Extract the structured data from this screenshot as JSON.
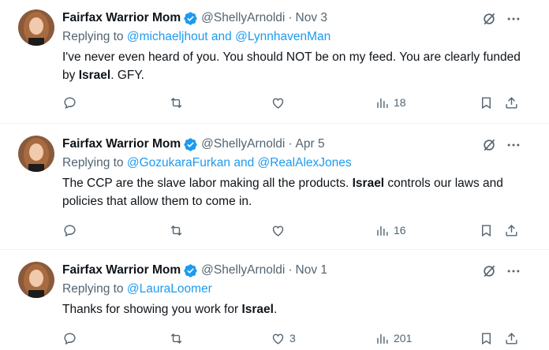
{
  "tweets": [
    {
      "author": "Fairfax Warrior Mom",
      "handle": "@ShellyArnoldi",
      "separator": "·",
      "date": "Nov 3",
      "replying_prefix": "Replying to ",
      "mentions": "@michaeljhout and @LynnhavenMan",
      "text_parts": [
        "I've never even heard of you. You should NOT be on my feed. You are clearly funded by ",
        "Israel",
        ". GFY."
      ],
      "likes": "",
      "views": "18"
    },
    {
      "author": "Fairfax Warrior Mom",
      "handle": "@ShellyArnoldi",
      "separator": "·",
      "date": "Apr 5",
      "replying_prefix": "Replying to ",
      "mentions": "@GozukaraFurkan and @RealAlexJones",
      "text_parts": [
        "The CCP are the slave labor making all the products. ",
        "Israel",
        " controls our laws and policies that allow them to come in."
      ],
      "likes": "",
      "views": "16"
    },
    {
      "author": "Fairfax Warrior Mom",
      "handle": "@ShellyArnoldi",
      "separator": "·",
      "date": "Nov 1",
      "replying_prefix": "Replying to ",
      "mentions": "@LauraLoomer",
      "text_parts": [
        "Thanks for showing you work for ",
        "Israel",
        "."
      ],
      "likes": "3",
      "views": "201"
    }
  ],
  "colors": {
    "text": "#0f1419",
    "secondary": "#536471",
    "link": "#1d9bf0",
    "verified": "#1d9bf0",
    "divider": "#eff3f4"
  },
  "icons": [
    "verified-badge-icon",
    "grok-icon",
    "more-icon",
    "reply-icon",
    "retweet-icon",
    "like-icon",
    "views-icon",
    "bookmark-icon",
    "share-icon"
  ]
}
